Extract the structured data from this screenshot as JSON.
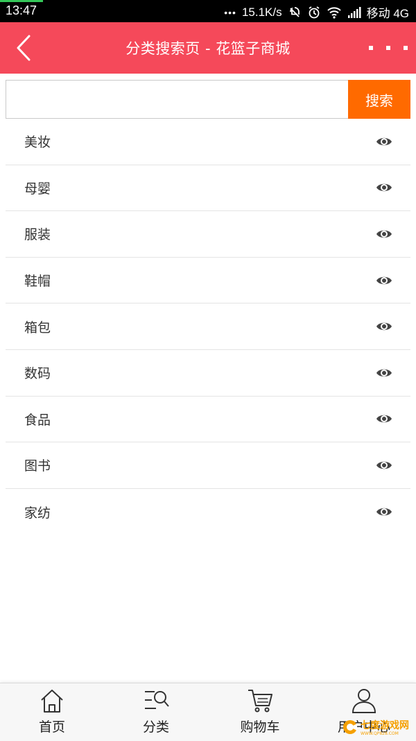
{
  "status_bar": {
    "time": "13:47",
    "net_speed": "15.1K/s",
    "carrier": "移动 4G"
  },
  "header": {
    "title": "分类搜索页 - 花篮子商城"
  },
  "search": {
    "placeholder": "",
    "value": "",
    "button_label": "搜索"
  },
  "categories": [
    {
      "label": "美妆"
    },
    {
      "label": "母婴"
    },
    {
      "label": "服装"
    },
    {
      "label": "鞋帽"
    },
    {
      "label": "箱包"
    },
    {
      "label": "数码"
    },
    {
      "label": "食品"
    },
    {
      "label": "图书"
    },
    {
      "label": "家纺"
    }
  ],
  "bottom_nav": [
    {
      "label": "首页",
      "icon": "home-icon"
    },
    {
      "label": "分类",
      "icon": "category-search-icon"
    },
    {
      "label": "购物车",
      "icon": "cart-icon"
    },
    {
      "label": "用户中心",
      "icon": "user-icon"
    }
  ],
  "watermark": {
    "text": "七度游戏网",
    "sub": "WWW.QP828.COM"
  },
  "colors": {
    "header_bg": "#f5495a",
    "search_button": "#ff6a00",
    "status_bar": "#000000"
  }
}
